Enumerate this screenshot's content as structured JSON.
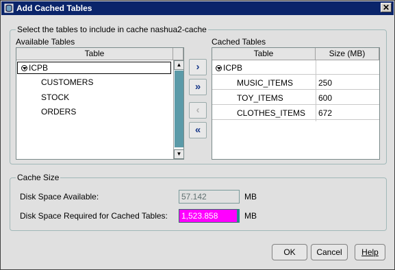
{
  "window": {
    "title": "Add Cached Tables",
    "close_glyph": "✕"
  },
  "tables_group": {
    "label": "Select the tables to include in cache nashua2-cache",
    "available": {
      "label": "Available Tables",
      "column": "Table",
      "root": "ICPB",
      "items": [
        "CUSTOMERS",
        "STOCK",
        "ORDERS"
      ]
    },
    "cached": {
      "label": "Cached Tables",
      "columns": [
        "Table",
        "Size (MB)"
      ],
      "root": "ICPB",
      "rows": [
        {
          "table": "MUSIC_ITEMS",
          "size": "250"
        },
        {
          "table": "TOY_ITEMS",
          "size": "600"
        },
        {
          "table": "CLOTHES_ITEMS",
          "size": "672"
        }
      ]
    },
    "move_buttons": {
      "add": "›",
      "add_all": "»",
      "remove": "‹",
      "remove_all": "«"
    }
  },
  "cache_size": {
    "label": "Cache Size",
    "available_label": "Disk Space Available:",
    "available_value": "57.142",
    "available_unit": "MB",
    "required_label": "Disk Space Required for Cached Tables:",
    "required_value": "1,523.858",
    "required_unit": "MB",
    "required_highlight_color": "#ff00ff"
  },
  "buttons": {
    "ok": "OK",
    "cancel": "Cancel",
    "help": "Help"
  }
}
